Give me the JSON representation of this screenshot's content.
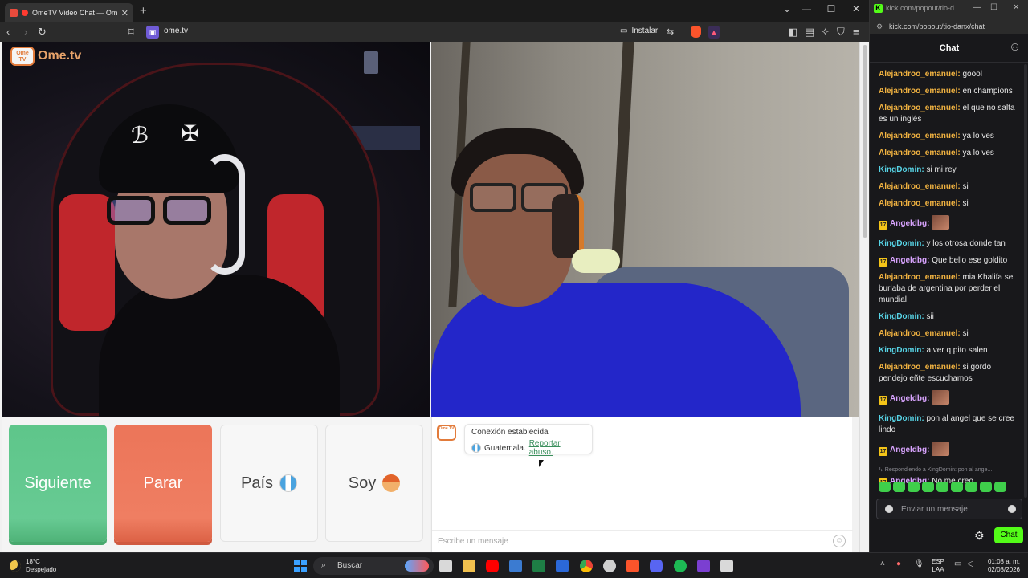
{
  "browser": {
    "tab_title": "OmeTV Video Chat — Omegl",
    "url": "ome.tv",
    "install_label": "Instalar"
  },
  "ometv": {
    "logo_text": "Ome.tv",
    "logo_badge": "Ome TV",
    "buttons": {
      "next": "Siguiente",
      "stop": "Parar",
      "country": "País",
      "gender": "Soy"
    },
    "connection": {
      "status": "Conexión establecida",
      "country": "Guatemala.",
      "report_link": "Reportar abuso."
    },
    "message_placeholder": "Escribe un mensaje"
  },
  "kick": {
    "window_title": "kick.com/popout/tio-d...",
    "address": "kick.com/popout/tio-danx/chat",
    "header": "Chat",
    "messages": [
      {
        "user": "Alejandroo_emanuel",
        "type": "ale",
        "text": "goool"
      },
      {
        "user": "Alejandroo_emanuel",
        "type": "ale",
        "text": "en champions"
      },
      {
        "user": "Alejandroo_emanuel",
        "type": "ale",
        "text": "el que no salta es un inglés"
      },
      {
        "user": "Alejandroo_emanuel",
        "type": "ale",
        "text": "ya lo ves"
      },
      {
        "user": "Alejandroo_emanuel",
        "type": "ale",
        "text": "ya lo ves"
      },
      {
        "user": "KingDomin",
        "type": "king",
        "text": "si mi rey"
      },
      {
        "user": "Alejandroo_emanuel",
        "type": "ale",
        "text": "si"
      },
      {
        "user": "Alejandroo_emanuel",
        "type": "ale",
        "text": "si"
      },
      {
        "user": "Angeldbg",
        "type": "angel",
        "badge": "17",
        "text": "",
        "emote": true
      },
      {
        "user": "KingDomin",
        "type": "king",
        "text": "y los otrosa donde tan"
      },
      {
        "user": "Angeldbg",
        "type": "angel",
        "badge": "17",
        "text": "Que bello ese goldito"
      },
      {
        "user": "Alejandroo_emanuel",
        "type": "ale",
        "text": "mia Khalifa se burlaba de argentina por perder el mundial"
      },
      {
        "user": "KingDomin",
        "type": "king",
        "text": "sii"
      },
      {
        "user": "Alejandroo_emanuel",
        "type": "ale",
        "text": "si"
      },
      {
        "user": "KingDomin",
        "type": "king",
        "text": "a ver q pito salen"
      },
      {
        "user": "Alejandroo_emanuel",
        "type": "ale",
        "text": "si gordo pendejo eñte escuchamos"
      },
      {
        "user": "Angeldbg",
        "type": "angel",
        "badge": "17",
        "text": "",
        "emote": true
      },
      {
        "user": "KingDomin",
        "type": "king",
        "text": "pon al angel que se cree lindo"
      },
      {
        "user": "Angeldbg",
        "type": "angel",
        "badge": "17",
        "text": "",
        "emote": true
      },
      {
        "user": "Angeldbg",
        "type": "angel",
        "badge": "17",
        "text": "No me creo",
        "reply": "Respondiendo a KingDomin: pon al ange..."
      }
    ],
    "input_placeholder": "Enviar un mensaje",
    "chat_button": "Chat"
  },
  "taskbar": {
    "weather_temp": "18°C",
    "weather_desc": "Despejado",
    "search_label": "Buscar",
    "lang_1": "ESP",
    "lang_2": "LAA",
    "time": "01:08 a. m.",
    "date": "02/08/2026"
  }
}
